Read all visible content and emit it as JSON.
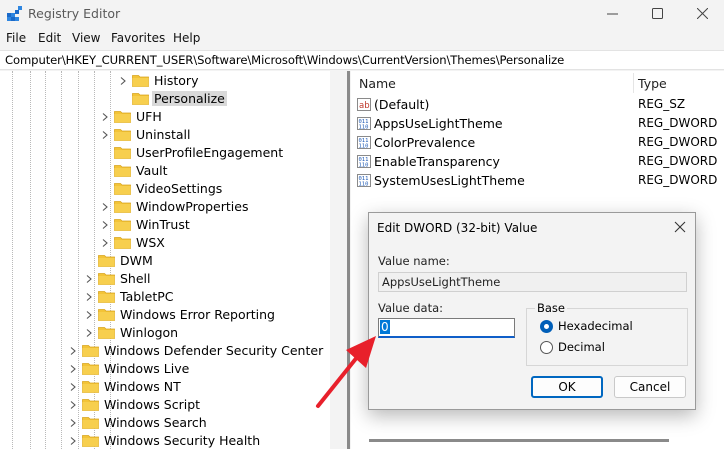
{
  "window": {
    "title": "Registry Editor"
  },
  "menu": [
    "File",
    "Edit",
    "View",
    "Favorites",
    "Help"
  ],
  "address": "Computer\\HKEY_CURRENT_USER\\Software\\Microsoft\\Windows\\CurrentVersion\\Themes\\Personalize",
  "tree": [
    {
      "label": "History",
      "chev": true
    },
    {
      "label": "Personalize",
      "chev": false,
      "selected": true
    },
    {
      "label": "UFH",
      "chev": true
    },
    {
      "label": "Uninstall",
      "chev": true
    },
    {
      "label": "UserProfileEngagement",
      "chev": false
    },
    {
      "label": "Vault",
      "chev": false
    },
    {
      "label": "VideoSettings",
      "chev": false
    },
    {
      "label": "WindowProperties",
      "chev": true
    },
    {
      "label": "WinTrust",
      "chev": true
    },
    {
      "label": "WSX",
      "chev": true
    },
    {
      "label": "DWM",
      "chev": false
    },
    {
      "label": "Shell",
      "chev": true
    },
    {
      "label": "TabletPC",
      "chev": true
    },
    {
      "label": "Windows Error Reporting",
      "chev": true
    },
    {
      "label": "Winlogon",
      "chev": true
    },
    {
      "label": "Windows Defender Security Center",
      "chev": true
    },
    {
      "label": "Windows Live",
      "chev": true
    },
    {
      "label": "Windows NT",
      "chev": true
    },
    {
      "label": "Windows Script",
      "chev": true
    },
    {
      "label": "Windows Search",
      "chev": true
    },
    {
      "label": "Windows Security Health",
      "chev": true
    }
  ],
  "values": {
    "col_name": "Name",
    "col_type": "Type",
    "rows": [
      {
        "name": "(Default)",
        "type": "REG_SZ",
        "icon": "string-value-icon"
      },
      {
        "name": "AppsUseLightTheme",
        "type": "REG_DWORD",
        "icon": "binary-value-icon"
      },
      {
        "name": "ColorPrevalence",
        "type": "REG_DWORD",
        "icon": "binary-value-icon"
      },
      {
        "name": "EnableTransparency",
        "type": "REG_DWORD",
        "icon": "binary-value-icon"
      },
      {
        "name": "SystemUsesLightTheme",
        "type": "REG_DWORD",
        "icon": "binary-value-icon"
      }
    ]
  },
  "dialog": {
    "title": "Edit DWORD (32-bit) Value",
    "value_name_label": "Value name:",
    "value_name": "AppsUseLightTheme",
    "value_data_label": "Value data:",
    "value_data": "0",
    "base_label": "Base",
    "hex_label": "Hexadecimal",
    "dec_label": "Decimal",
    "base_selected": "Hexadecimal",
    "ok": "OK",
    "cancel": "Cancel"
  },
  "colors": {
    "accent": "#0067c0",
    "arrow": "#e8202b",
    "folder": "#f3c437"
  }
}
